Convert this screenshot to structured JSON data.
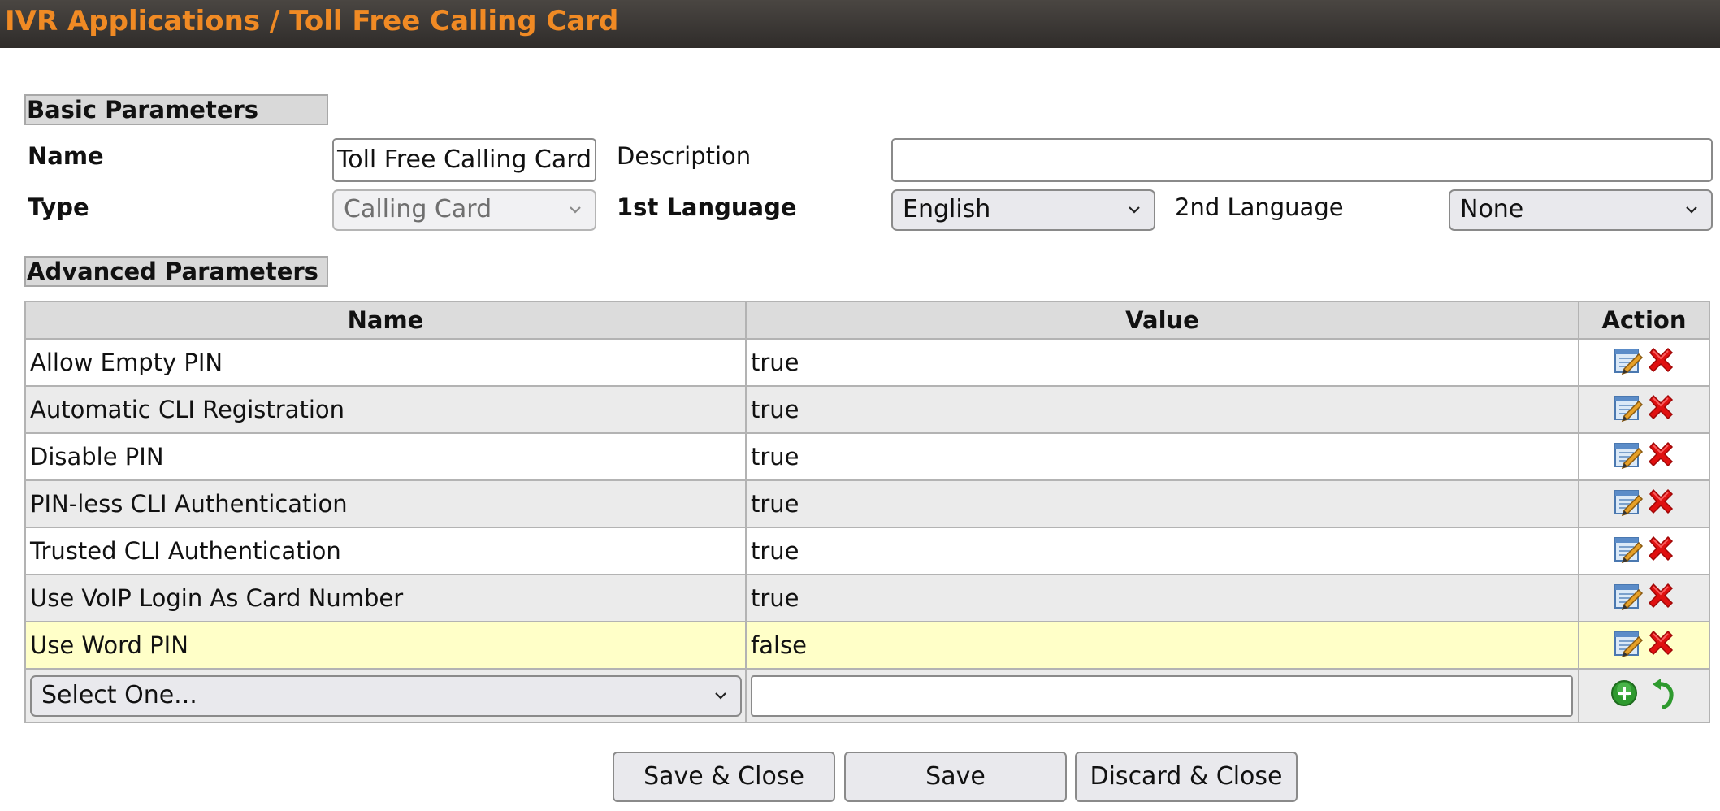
{
  "header": {
    "title": "IVR Applications / Toll Free Calling Card"
  },
  "basic": {
    "section_label": "Basic Parameters",
    "name_label": "Name",
    "name_value": "Toll Free Calling Card",
    "description_label": "Description",
    "description_value": "",
    "type_label": "Type",
    "type_value": "Calling Card",
    "lang1_label": "1st Language",
    "lang1_value": "English",
    "lang2_label": "2nd Language",
    "lang2_value": "None"
  },
  "advanced": {
    "section_label": "Advanced Parameters",
    "columns": [
      "Name",
      "Value",
      "Action"
    ],
    "rows": [
      {
        "name": "Allow Empty PIN",
        "value": "true"
      },
      {
        "name": "Automatic CLI Registration",
        "value": "true"
      },
      {
        "name": "Disable PIN",
        "value": "true"
      },
      {
        "name": "PIN-less CLI Authentication",
        "value": "true"
      },
      {
        "name": "Trusted CLI Authentication",
        "value": "true"
      },
      {
        "name": "Use VoIP Login As Card Number",
        "value": "true"
      },
      {
        "name": "Use Word PIN",
        "value": "false"
      }
    ],
    "new_param_select": "Select One...",
    "new_param_value": ""
  },
  "buttons": {
    "save_close": "Save & Close",
    "save": "Save",
    "discard_close": "Discard & Close"
  },
  "colors": {
    "title": "#f08a24",
    "header_bg": "#3a3734",
    "highlight_row": "#ffffc8",
    "delete_icon": "#e01010",
    "add_icon": "#2e9a2e"
  },
  "icons": {
    "edit": "edit-icon",
    "delete": "delete-icon",
    "add": "add-icon",
    "undo": "undo-icon"
  }
}
